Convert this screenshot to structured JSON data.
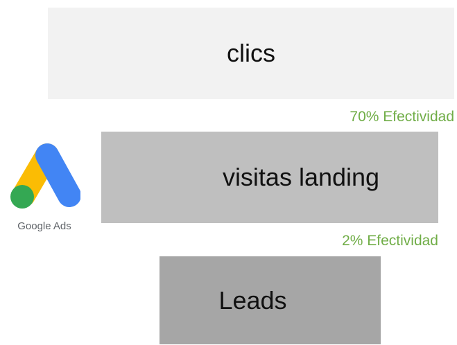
{
  "funnel": {
    "stages": [
      {
        "label": "clics"
      },
      {
        "label": "visitas landing"
      },
      {
        "label": "Leads"
      }
    ],
    "rates": [
      {
        "text": "70% Efectividad"
      },
      {
        "text": "2% Efectividad"
      }
    ]
  },
  "logo": {
    "text": "Google Ads",
    "icon": "google-ads-icon",
    "colors": {
      "blue": "#4285f4",
      "yellow": "#fbbc04",
      "green": "#34a853"
    }
  },
  "colors": {
    "stage_top": "#f2f2f2",
    "stage_mid": "#bfbfbf",
    "stage_bot": "#a6a6a6",
    "rate_text": "#70ad47"
  }
}
